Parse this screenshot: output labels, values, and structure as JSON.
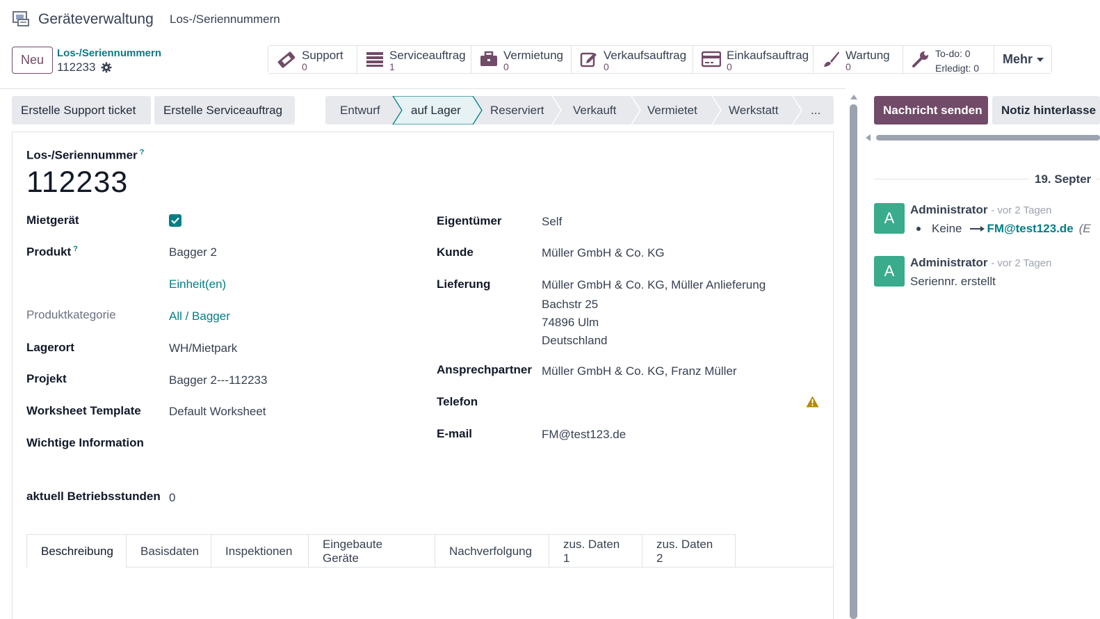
{
  "nav": {
    "app_title": "Geräteverwaltung",
    "menu_item": "Los-/Seriennummern"
  },
  "control": {
    "new_label": "Neu",
    "breadcrumb_parent": "Los-/Seriennummern",
    "breadcrumb_current": "112233"
  },
  "smart_buttons": {
    "support": {
      "label": "Support",
      "count": "0"
    },
    "serviceauftrag": {
      "label": "Serviceauftrag",
      "count": "1"
    },
    "vermietung": {
      "label": "Vermietung",
      "count": "0"
    },
    "verkaufsauftrag": {
      "label": "Verkaufsauftrag",
      "count": "0"
    },
    "einkaufsauftrag": {
      "label": "Einkaufsauftrag",
      "count": "0"
    },
    "wartung": {
      "label": "Wartung",
      "count": "0"
    },
    "todo": {
      "todo_label": "To-do: 0",
      "done_label": "Erledigt: 0"
    },
    "more": "Mehr"
  },
  "actions": {
    "support_ticket": "Erstelle Support ticket",
    "serviceauftrag": "Erstelle Serviceauftrag"
  },
  "statusbar": [
    "Entwurf",
    "auf Lager",
    "Reserviert",
    "Verkauft",
    "Vermietet",
    "Werkstatt",
    "..."
  ],
  "form": {
    "title_label": "Los-/Seriennummer",
    "help_mark": "?",
    "serial": "112233",
    "left": {
      "mietgeraet_label": "Mietgerät",
      "produkt_label": "Produkt",
      "produkt_value": "Bagger 2",
      "einheit_link": "Einheit(en)",
      "kategorie_label": "Produktkategorie",
      "kategorie_value": "All / Bagger",
      "lagerort_label": "Lagerort",
      "lagerort_value": "WH/Mietpark",
      "projekt_label": "Projekt",
      "projekt_value": "Bagger 2---112233",
      "worksheet_label": "Worksheet Template",
      "worksheet_value": "Default Worksheet",
      "wichtig_label": "Wichtige Information",
      "betriebsstunden_label": "aktuell Betriebsstunden",
      "betriebsstunden_value": "0"
    },
    "right": {
      "eigentuemer_label": "Eigentümer",
      "eigentuemer_value": "Self",
      "kunde_label": "Kunde",
      "kunde_value": "Müller GmbH & Co. KG",
      "lieferung_label": "Lieferung",
      "lieferung_line1": "Müller GmbH & Co. KG, Müller Anlieferung",
      "lieferung_line2": "Bachstr 25",
      "lieferung_line3": "74896 Ulm",
      "lieferung_line4": "Deutschland",
      "ansprech_label": "Ansprechpartner",
      "ansprech_value": "Müller GmbH & Co. KG, Franz Müller",
      "telefon_label": "Telefon",
      "email_label": "E-mail",
      "email_value": "FM@test123.de"
    },
    "tabs": [
      "Beschreibung",
      "Basisdaten",
      "Inspektionen",
      "Eingebaute Geräte",
      "Nachverfolgung",
      "zus. Daten 1",
      "zus. Daten 2"
    ]
  },
  "chatter": {
    "send_message": "Nachricht senden",
    "log_note": "Notiz hinterlasse",
    "date_separator": "19. Septer",
    "messages": [
      {
        "avatar": "A",
        "author": "Administrator",
        "ago": "- vor 2 Tagen",
        "old": "Keine",
        "new": "FM@test123.de",
        "suffix": "(E"
      },
      {
        "avatar": "A",
        "author": "Administrator",
        "ago": "- vor 2 Tagen",
        "body": "Seriennr. erstellt"
      }
    ]
  },
  "colors": {
    "primary": "#714b67",
    "link": "#017e84",
    "avatar": "#3aab8c",
    "warning": "#b58900"
  }
}
